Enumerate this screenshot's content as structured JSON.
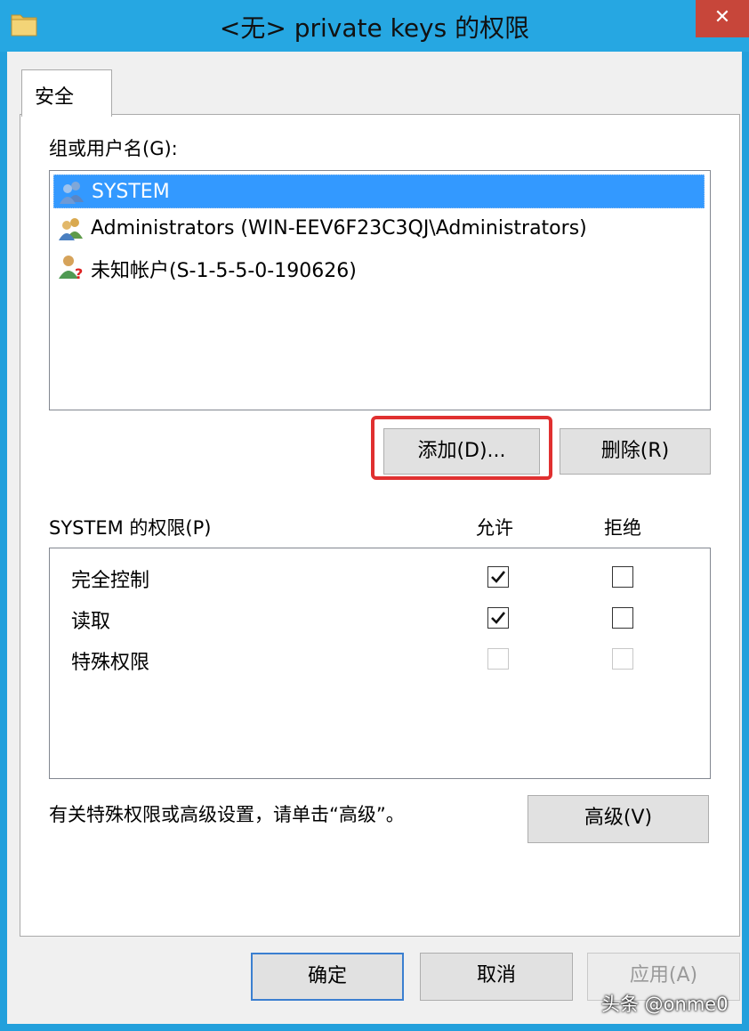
{
  "window": {
    "title": "<无> private keys 的权限",
    "close_label": "✕",
    "icon": "folder-icon"
  },
  "tabs": [
    {
      "label": "安全",
      "active": true
    }
  ],
  "security": {
    "group_label": "组或用户名(G):",
    "principals": [
      {
        "name": "SYSTEM",
        "icon": "users-icon",
        "selected": true
      },
      {
        "name": "Administrators (WIN-EEV6F23C3QJ\\Administrators)",
        "icon": "users-icon",
        "selected": false
      },
      {
        "name": "未知帐户(S-1-5-5-0-190626)",
        "icon": "unknown-user-icon",
        "selected": false
      }
    ],
    "add_label": "添加(D)...",
    "remove_label": "删除(R)",
    "perm_label": "SYSTEM 的权限(P)",
    "allow_header": "允许",
    "deny_header": "拒绝",
    "permissions": [
      {
        "name": "完全控制",
        "allow": true,
        "deny": false,
        "enabled": true
      },
      {
        "name": "读取",
        "allow": true,
        "deny": false,
        "enabled": true
      },
      {
        "name": "特殊权限",
        "allow": false,
        "deny": false,
        "enabled": false
      }
    ],
    "advanced_hint": "有关特殊权限或高级设置，请单击“高级”。",
    "advanced_label": "高级(V)"
  },
  "footer": {
    "ok_label": "确定",
    "cancel_label": "取消",
    "apply_label": "应用(A)"
  },
  "watermark": "头条 @onme0",
  "colors": {
    "titlebar": "#26a7e2",
    "selection": "#3399ff",
    "close": "#c7463a",
    "highlight": "#e03030"
  }
}
